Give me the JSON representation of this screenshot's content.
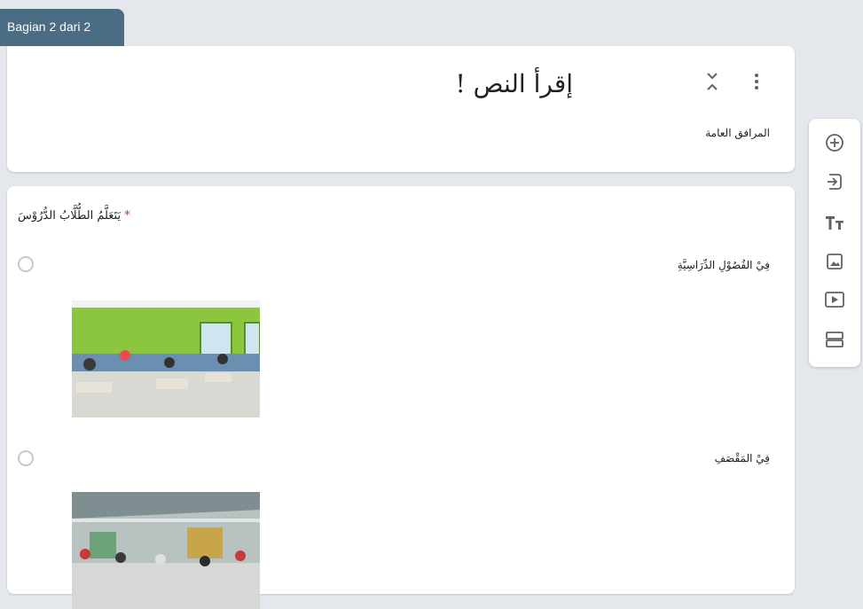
{
  "section_tab": {
    "label": "Bagian 2 dari 2"
  },
  "header_card": {
    "title": "إقرأ النص !",
    "subtitle": "المرافق العامة"
  },
  "question": {
    "title": "يَتَعَلَّمُ الطُّلَّابُ الدُّرُوْسَ",
    "required_mark": "*",
    "options": [
      {
        "label": "فِيْ الفُصُوْلِ الدِّرَاسِيَّةِ",
        "image": "classroom-photo"
      },
      {
        "label": "فِيْ المَقْصَفِ",
        "image": "canteen-photo"
      }
    ]
  },
  "toolbar": {
    "items": [
      {
        "name": "add-question",
        "icon": "plus-circle-icon"
      },
      {
        "name": "import-questions",
        "icon": "import-icon"
      },
      {
        "name": "add-title",
        "icon": "title-text-icon"
      },
      {
        "name": "add-image",
        "icon": "image-icon"
      },
      {
        "name": "add-video",
        "icon": "video-icon"
      },
      {
        "name": "add-section",
        "icon": "section-icon"
      }
    ]
  },
  "colors": {
    "accent": "#4a6d84",
    "background": "#e4e8ec",
    "required": "#d93025"
  }
}
